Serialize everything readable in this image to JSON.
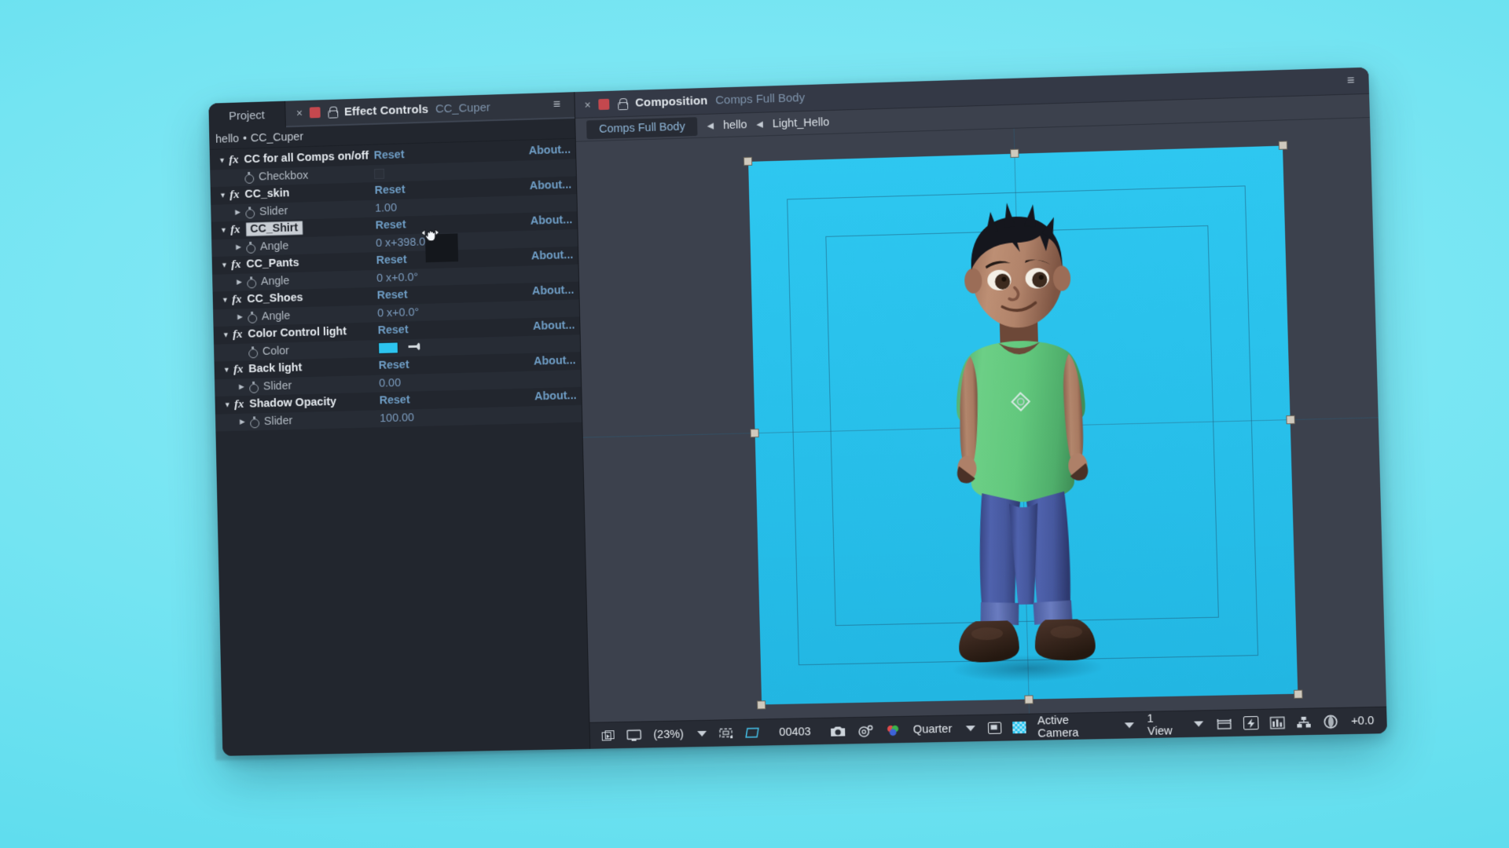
{
  "background": {
    "color": "#6ee4f2"
  },
  "app": {
    "name": "Adobe After Effects",
    "window_color": "#2d323c"
  },
  "left_panel": {
    "tabs": [
      {
        "label": "Project",
        "active": false,
        "name": "tab-project"
      }
    ],
    "effect_controls_tab": {
      "close_label": "×",
      "title": "Effect Controls",
      "subtitle": "CC_Cuper",
      "menu_glyph": "≡",
      "swatch_color": "#c4484e",
      "lock_icon": "lock-icon"
    },
    "breadcrumb": {
      "comp": "hello",
      "separator": "•",
      "layer": "CC_Cuper"
    },
    "columns": {
      "reset": "Reset",
      "about": "About..."
    },
    "effects": [
      {
        "name": "CC for all Comps on/off",
        "expanded": true,
        "selected": false,
        "reset": "Reset",
        "about": "About...",
        "properties": [
          {
            "name": "Checkbox",
            "value": "",
            "type": "checkbox",
            "has_arrow": false
          }
        ]
      },
      {
        "name": "CC_skin",
        "expanded": true,
        "selected": false,
        "reset": "Reset",
        "about": "About...",
        "properties": [
          {
            "name": "Slider",
            "value": "1.00",
            "type": "number",
            "has_arrow": true
          }
        ]
      },
      {
        "name": "CC_Shirt",
        "expanded": true,
        "selected": true,
        "reset": "Reset",
        "about": "About...",
        "properties": [
          {
            "name": "Angle",
            "value": "0 x+398.0°",
            "type": "angle",
            "has_arrow": true
          }
        ]
      },
      {
        "name": "CC_Pants",
        "expanded": true,
        "selected": false,
        "reset": "Reset",
        "about": "About...",
        "properties": [
          {
            "name": "Angle",
            "value": "0 x+0.0°",
            "type": "angle",
            "has_arrow": true
          }
        ]
      },
      {
        "name": "CC_Shoes",
        "expanded": true,
        "selected": false,
        "reset": "Reset",
        "about": "About...",
        "properties": [
          {
            "name": "Angle",
            "value": "0 x+0.0°",
            "type": "angle",
            "has_arrow": true
          }
        ]
      },
      {
        "name": "Color Control light",
        "expanded": true,
        "selected": false,
        "reset": "Reset",
        "about": "About...",
        "properties": [
          {
            "name": "Color",
            "value": "#2cc4ef",
            "type": "color",
            "has_arrow": false
          }
        ]
      },
      {
        "name": "Back light",
        "expanded": true,
        "selected": false,
        "reset": "Reset",
        "about": "About...",
        "properties": [
          {
            "name": "Slider",
            "value": "0.00",
            "type": "number",
            "has_arrow": true
          }
        ]
      },
      {
        "name": "Shadow Opacity",
        "expanded": true,
        "selected": false,
        "reset": "Reset",
        "about": "About...",
        "properties": [
          {
            "name": "Slider",
            "value": "100.00",
            "type": "number",
            "has_arrow": true
          }
        ]
      }
    ]
  },
  "right_panel": {
    "tab": {
      "close_label": "×",
      "swatch_color": "#c4484e",
      "title": "Composition",
      "subtitle": "Comps Full Body",
      "menu_glyph": "≡",
      "lock_icon": "lock-icon"
    },
    "breadcrumbs": [
      {
        "label": "Comps Full Body",
        "active": true
      },
      {
        "label": "hello",
        "active": false
      },
      {
        "label": "Light_Hello",
        "active": false
      }
    ],
    "crumb_arrow": "◀",
    "viewport": {
      "comp_background": "#2cc5ef",
      "guides": [
        "action-safe",
        "title-safe"
      ],
      "anchor_point": "anchor-point-widget"
    },
    "toolbar": {
      "zoom_level": "(23%)",
      "time": "00403",
      "resolution": "Quarter",
      "camera": "Active Camera",
      "views": "1 View",
      "exposure": "+0.0",
      "icons": [
        "always-preview-icon",
        "monitor-icon",
        "zoom-caret-icon",
        "grid-options-icon",
        "region-of-interest-icon",
        "snapshot-icon",
        "show-snapshot-icon",
        "channels-icon",
        "resolution-caret-icon",
        "mask-view-icon",
        "transparency-grid-icon",
        "camera-caret-icon",
        "views-caret-icon",
        "pixel-aspect-icon",
        "fast-preview-icon",
        "timeline-icon",
        "comp-flowchart-icon",
        "exposure-icon"
      ]
    }
  },
  "character": {
    "description": "3D cartoon boy character standing",
    "skin_color": "#b0826a",
    "shirt_color": "#5ec97f",
    "pants_color": "#4a5ba4",
    "shoes_color": "#3c2a22",
    "hair_color": "#14151c"
  },
  "cursor": {
    "type": "scrub-horizontal-hand-cursor",
    "tooltip_box": true
  }
}
